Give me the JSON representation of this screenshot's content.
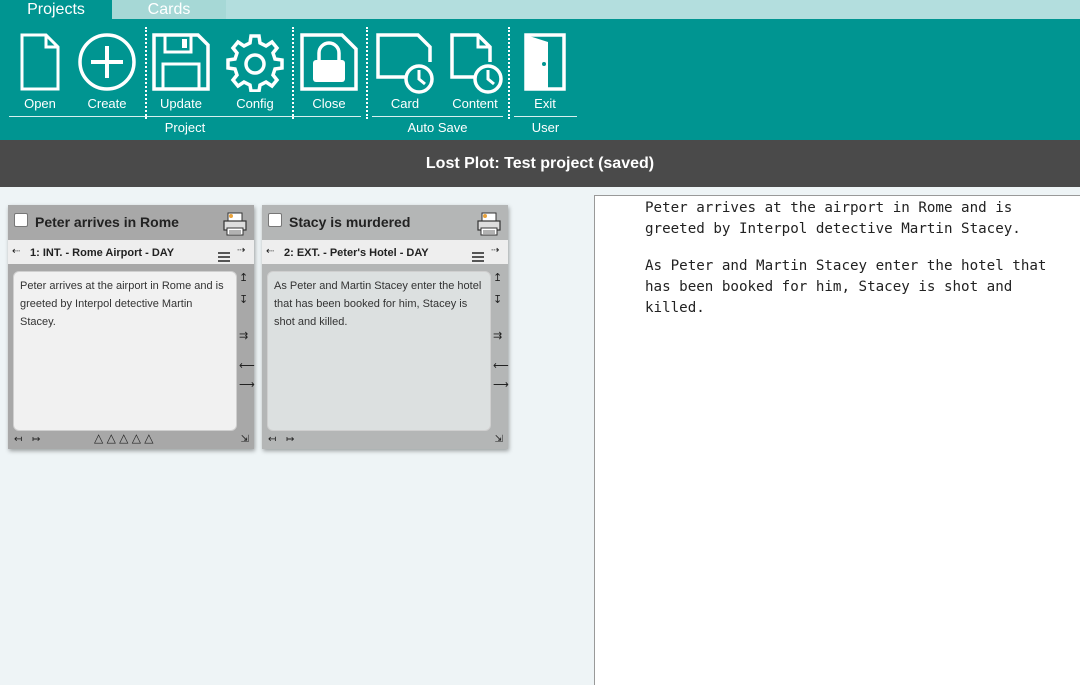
{
  "tabs": [
    {
      "label": "Projects"
    },
    {
      "label": "Cards"
    }
  ],
  "ribbon": {
    "buttons": {
      "open": "Open",
      "create": "Create",
      "update": "Update",
      "config": "Config",
      "close": "Close",
      "card": "Card",
      "content": "Content",
      "exit": "Exit"
    },
    "groups": {
      "project": "Project",
      "autosave": "Auto Save",
      "user": "User"
    },
    "colors": {
      "accent": "#009591",
      "tab_inactive": "#a6d8d6"
    }
  },
  "titlebar": {
    "text": "Lost Plot: Test project (saved)"
  },
  "cards": [
    {
      "title": "Peter arrives in Rome",
      "scene": "1: INT. - Rome Airport - DAY",
      "body": "Peter arrives at the airport in Rome and is greeted by Interpol detective Martin Stacey.",
      "rating": "△ △ △ △ △"
    },
    {
      "title": "Stacy is murdered",
      "scene": "2: EXT. - Peter's Hotel - DAY",
      "body": "As Peter and Martin Stacey enter the hotel that has been booked for him, Stacey is shot and killed."
    }
  ],
  "glyphs": {
    "arrow_left_dots": "⇠",
    "arrow_right_dots": "⇢",
    "up_bar": "↥",
    "down_bar": "↧",
    "double_right": "⇉",
    "left": "⟵",
    "right": "⟶",
    "shrink": "↤",
    "expand": "↦",
    "resize": "⇲"
  },
  "preview": {
    "paragraphs": [
      "Peter arrives at the airport in Rome and is greeted by Interpol detective Martin Stacey.",
      "As Peter and Martin Stacey enter the hotel that has been booked for him, Stacey is shot and killed."
    ]
  }
}
